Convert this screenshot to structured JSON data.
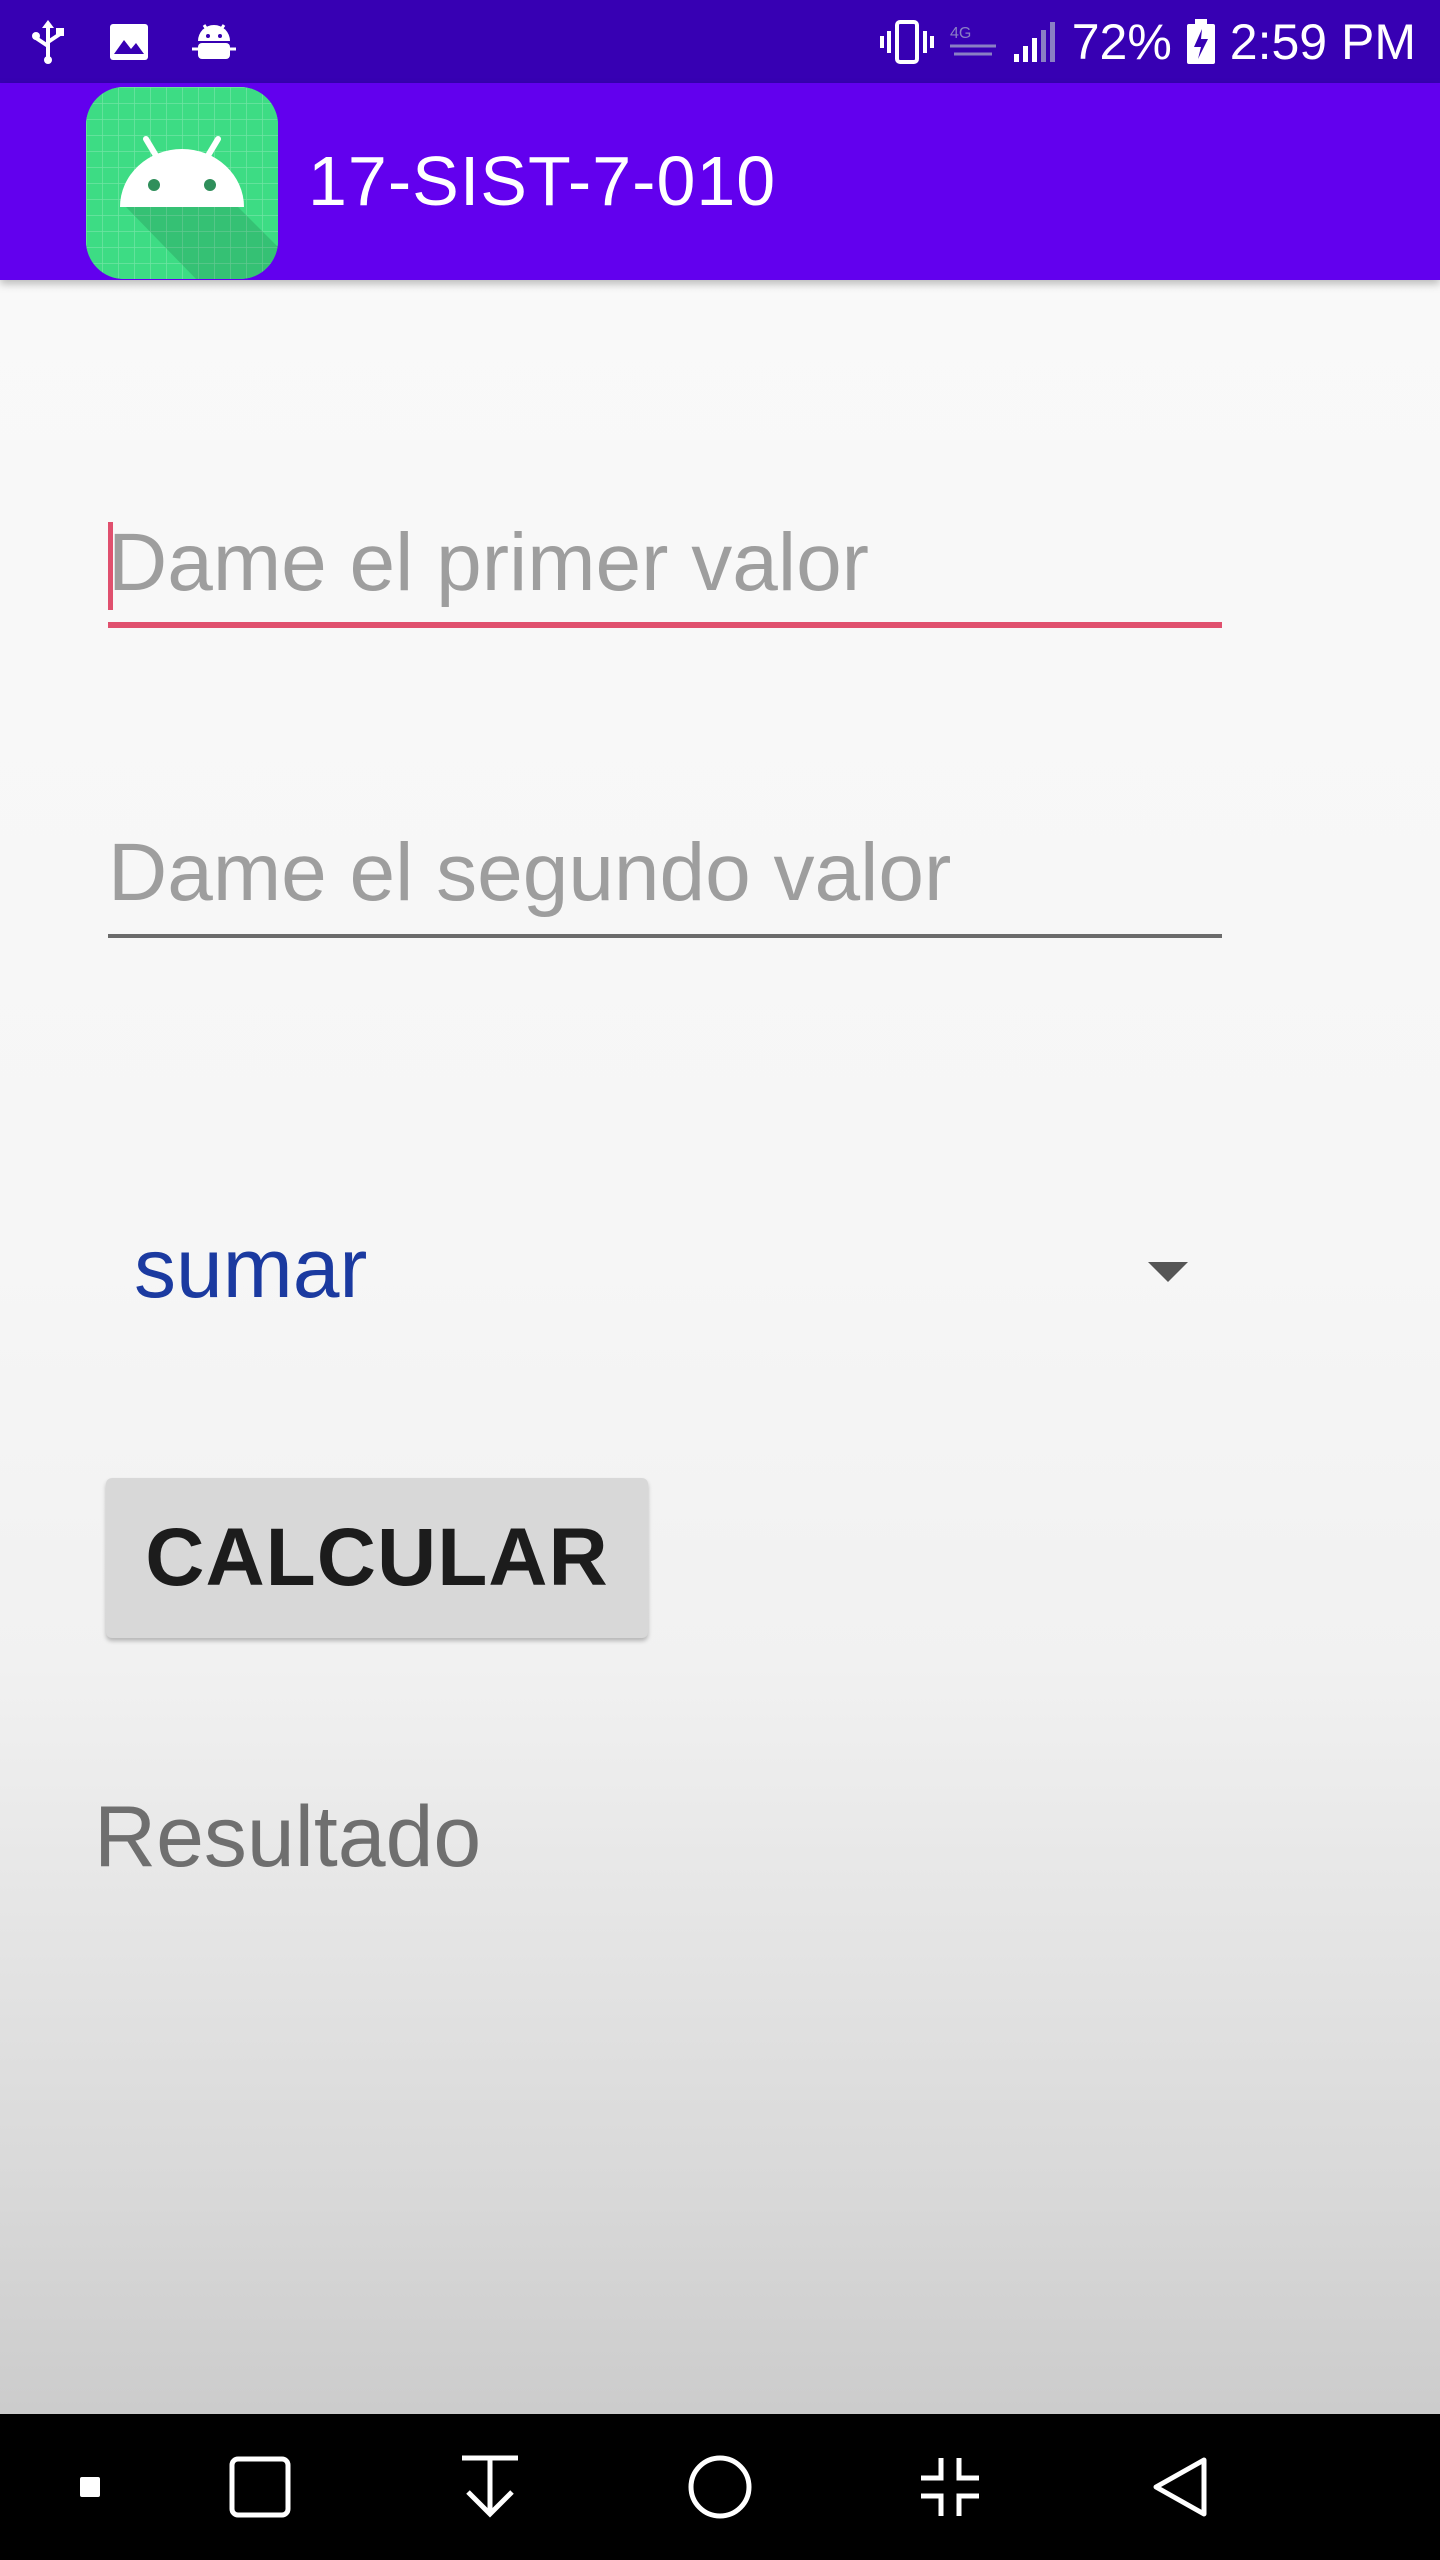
{
  "status_bar": {
    "left_icons": [
      "usb-icon",
      "image-icon",
      "android-debug-icon"
    ],
    "right_icons": [
      "vibrate-icon",
      "lte-icon",
      "signal-icon",
      "battery-icon"
    ],
    "battery": "72%",
    "time": "2:59 PM"
  },
  "app_bar": {
    "title": "17-SIST-7-010",
    "logo_icon": "android-icon",
    "color": "#6200ee",
    "status_color": "#3700b3"
  },
  "form": {
    "first_value": {
      "placeholder": "Dame el primer valor",
      "value": "",
      "focused": true
    },
    "second_value": {
      "placeholder": "Dame el segundo valor",
      "value": ""
    },
    "operation": {
      "selected": "sumar"
    },
    "calculate_label": "CALCULAR",
    "result_label": "Resultado"
  },
  "nav_bar": {
    "buttons": [
      "dot-icon",
      "recents-icon",
      "download-icon",
      "home-icon",
      "collapse-icon",
      "back-icon"
    ]
  }
}
